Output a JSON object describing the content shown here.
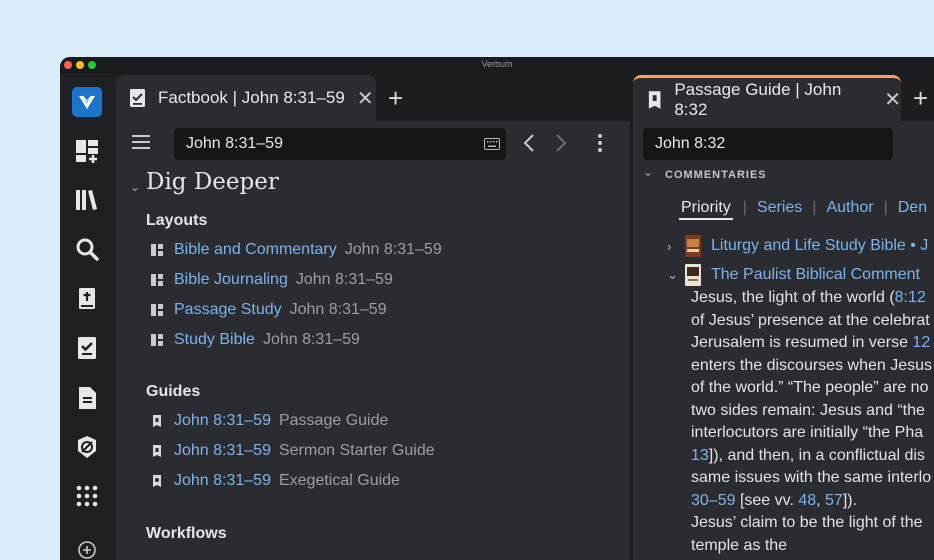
{
  "app": {
    "title": "Verbum"
  },
  "rail": {
    "items": [
      {
        "name": "verbum-logo-icon"
      },
      {
        "name": "layouts-add-icon"
      },
      {
        "name": "library-icon"
      },
      {
        "name": "search-icon"
      },
      {
        "name": "bible-icon"
      },
      {
        "name": "checklist-icon"
      },
      {
        "name": "document-icon"
      },
      {
        "name": "guide-icon"
      },
      {
        "name": "apps-grid-icon"
      },
      {
        "name": "add-circle-icon"
      }
    ]
  },
  "left": {
    "tab_title": "Factbook | John 8:31–59",
    "search_value": "John 8:31–59",
    "heading": "Dig Deeper",
    "layouts": {
      "title": "Layouts",
      "items": [
        {
          "label": "Bible and Commentary",
          "ref": "John 8:31–59"
        },
        {
          "label": "Bible Journaling",
          "ref": "John 8:31–59"
        },
        {
          "label": "Passage Study",
          "ref": "John 8:31–59"
        },
        {
          "label": "Study Bible",
          "ref": "John 8:31–59"
        }
      ]
    },
    "guides": {
      "title": "Guides",
      "items": [
        {
          "label": "John 8:31–59",
          "ref": "Passage Guide"
        },
        {
          "label": "John 8:31–59",
          "ref": "Sermon Starter Guide"
        },
        {
          "label": "John 8:31–59",
          "ref": "Exegetical Guide"
        }
      ]
    },
    "workflows": {
      "title": "Workflows"
    }
  },
  "right": {
    "tab_title": "Passage Guide | John 8:32",
    "search_value": "John 8:32",
    "section_label": "COMMENTARIES",
    "filters": {
      "active": "Priority",
      "others": [
        "Series",
        "Author",
        "Den"
      ]
    },
    "books": [
      {
        "title": "Liturgy and Life Study Bible • J",
        "expanded": false
      },
      {
        "title": "The Paulist Biblical Comment",
        "expanded": true
      }
    ],
    "body": {
      "l1a": "Jesus, the light of the world (",
      "l1link": "8:12",
      "l2": "of Jesus’ presence at the celebrat",
      "l3a": "Jerusalem is resumed in verse ",
      "l3link": "12",
      "l4": "enters the discourses when Jesus",
      "l5": "of the world.” “The people” are no",
      "l6": "two sides remain: Jesus and “the",
      "l7": "interlocutors are initially “the Pha",
      "l8link": "13",
      "l8b": "]), and then, in a conflictual dis",
      "l9": "same issues with the same interlo",
      "l10link": "30–59",
      "l10b": " [see vv. ",
      "l10c": "48",
      "l10d": ", ",
      "l10e": "57",
      "l10f": "]).",
      "l11": "Jesus’ claim to be the light of the",
      "l12": "temple as the"
    }
  },
  "colors": {
    "accent": "#f2a16b",
    "link": "#7fb2ea",
    "logo": "#1e74c9"
  }
}
